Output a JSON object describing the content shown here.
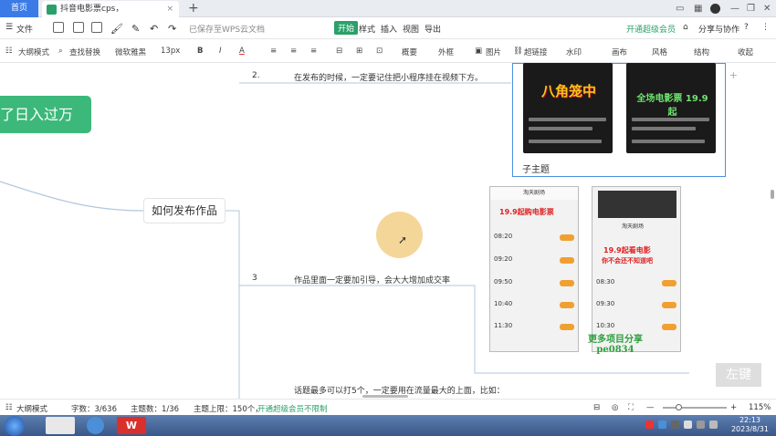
{
  "tabs": {
    "home": "首页",
    "doc": "抖音电影票cps，",
    "close": "×",
    "add": "+"
  },
  "menu": {
    "file": "文件",
    "save_status": "已保存至WPS云文档",
    "start": "开始",
    "style": "样式",
    "insert": "插入",
    "view": "视图",
    "export": "导出",
    "vip": "开通超级会员",
    "share": "分享与协作",
    "help": "?"
  },
  "toolbar": {
    "outline": "大纲模式",
    "find": "查找替换",
    "font": "微软雅黑",
    "size": "13px",
    "bold": "B",
    "italic": "I",
    "color": "A",
    "summary": "概要",
    "frame": "外框",
    "image": "图片",
    "link": "超链接",
    "watermark": "水印",
    "canvas": "画布",
    "style": "风格",
    "structure": "结构",
    "collapse": "收起"
  },
  "mindmap": {
    "root_text": "了日入过万",
    "topic": "如何发布作品",
    "items": [
      {
        "num": "2.",
        "text": "在发布的时候，一定要记住把小程序挂在视频下方。"
      },
      {
        "num": "3",
        "text": "作品里面一定要加引导，会大大增加成交率"
      },
      {
        "num": "",
        "text": "话题最多可以打5个，一定要用在流量最大的上面，比如："
      }
    ],
    "child_label": "子主题",
    "poster1_title": "八角笼中",
    "poster2_title": "全场电影票 19.9起",
    "phone1_title": "19.9起购电影票",
    "phone2_title": "19.9起看电影",
    "phone2_sub": "你不会还不知道吧",
    "phone_header": "淘天剧场",
    "times": [
      "08:20",
      "09:20",
      "09:50",
      "10:40",
      "11:30"
    ],
    "times2": [
      "08:30",
      "09:30",
      "10:30"
    ],
    "watermark": "更多项目分享 pe0834",
    "left_key": "左键"
  },
  "status": {
    "outline_mode": "大纲模式",
    "words": "字数：3/636",
    "topics": "主题数：1/36",
    "limit": "主题上限：150个，",
    "vip_limit": "开通超级会员不限制",
    "zoom": "115%"
  },
  "clock": {
    "time": "22:13",
    "date": "2023/8/31"
  }
}
